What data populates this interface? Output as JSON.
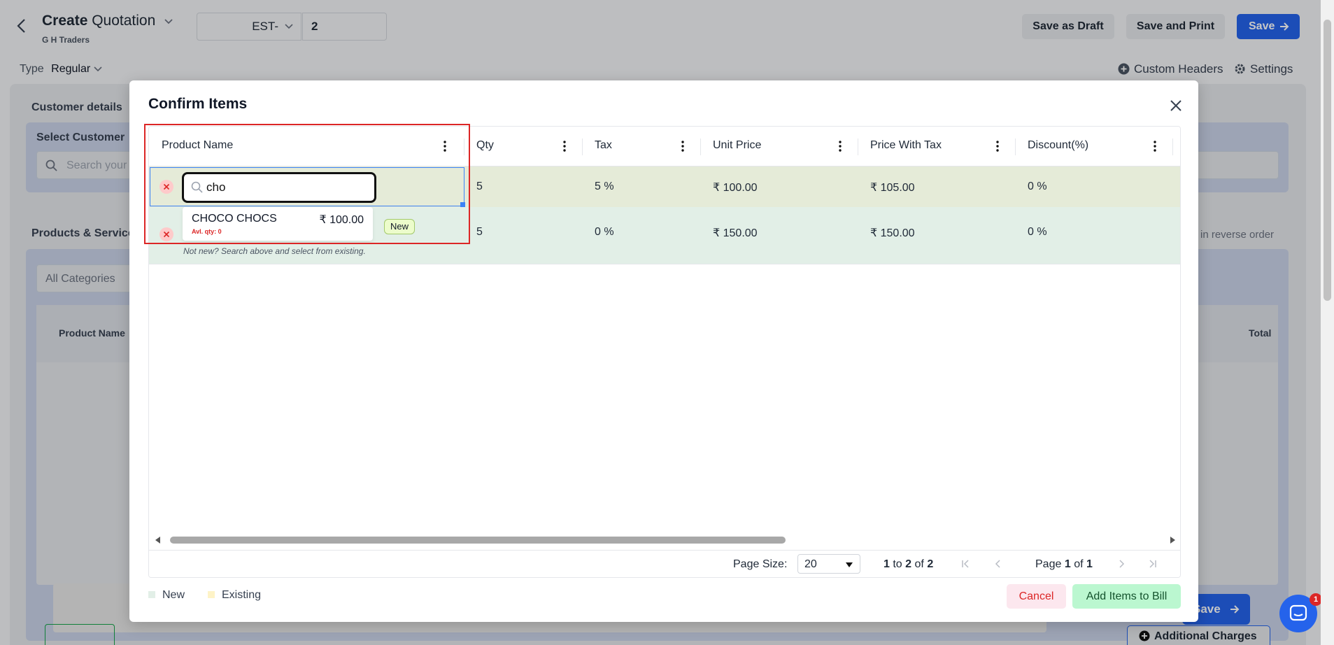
{
  "header": {
    "title_bold": "Create",
    "title_rest": "Quotation",
    "company": "G H Traders",
    "prefix": "EST-",
    "number": "2",
    "save_draft": "Save as Draft",
    "save_print": "Save and Print",
    "save": "Save"
  },
  "toolbar": {
    "type_label": "Type",
    "type_value": "Regular",
    "custom_headers": "Custom Headers",
    "settings": "Settings"
  },
  "customer": {
    "section_label": "Customer details",
    "select_label": "Select Customer",
    "search_placeholder": "Search your"
  },
  "products": {
    "section_label": "Products & Service",
    "reverse_order": "in reverse order",
    "category": "All Categories",
    "col_product": "Product Name",
    "col_total": "Total"
  },
  "bottom": {
    "save": "Save",
    "additional_charges": "Additional Charges"
  },
  "chat": {
    "badge": "1"
  },
  "modal": {
    "title": "Confirm Items",
    "columns": [
      "Product Name",
      "Qty",
      "Tax",
      "Unit Price",
      "Price With Tax",
      "Discount(%)"
    ],
    "rows": [
      {
        "qty": "5",
        "tax": "5 %",
        "unit_price": "₹ 100.00",
        "price_with_tax": "₹ 105.00",
        "discount": "0 %"
      },
      {
        "qty": "5",
        "tax": "0 %",
        "unit_price": "₹ 150.00",
        "price_with_tax": "₹ 150.00",
        "discount": "0 %"
      }
    ],
    "search_value": "cho",
    "dropdown": {
      "name": "CHOCO CHOCS",
      "price": "₹ 100.00",
      "avl_qty": "Avl. qty: 0"
    },
    "new_badge": "New",
    "not_new_hint": "Not new? Search above and select from existing.",
    "pager": {
      "page_size_label": "Page Size:",
      "page_size": "20",
      "range_from": "1",
      "range_to_word": "to",
      "range_to": "2",
      "of_word": "of",
      "range_total": "2",
      "page_word": "Page",
      "page_current": "1",
      "page_of": "of",
      "page_total": "1"
    },
    "legend_new": "New",
    "legend_existing": "Existing",
    "cancel": "Cancel",
    "add_items": "Add Items to Bill"
  }
}
